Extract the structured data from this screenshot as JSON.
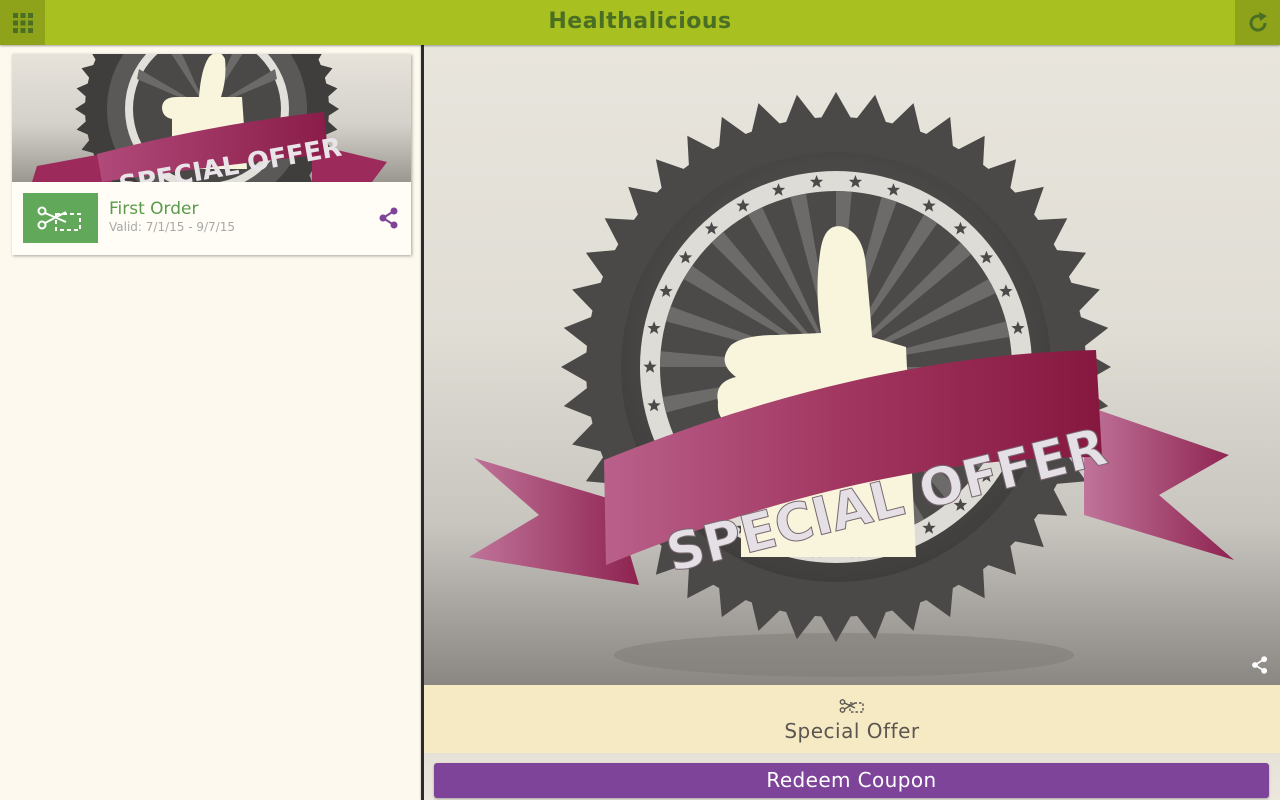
{
  "app": {
    "title": "Healthalicious"
  },
  "topbar": {
    "menu_icon": "grid-icon",
    "refresh_icon": "refresh-icon"
  },
  "coupon_list": [
    {
      "title": "First Order",
      "valid": "Valid: 7/1/15 - 9/7/15",
      "image_text": "SPECIAL OFFER"
    }
  ],
  "detail": {
    "image_text": "SPECIAL OFFER",
    "offer_title": "Special Offer",
    "redeem_label": "Redeem Coupon"
  },
  "colors": {
    "topbar": "#a8c020",
    "title_text": "#4a6f24",
    "badge": "#62a85a",
    "redeem_button": "#7d4499",
    "share_icon": "#7d4499",
    "ribbon": "#9c2a5a",
    "offer_bar": "#f6eac4"
  }
}
